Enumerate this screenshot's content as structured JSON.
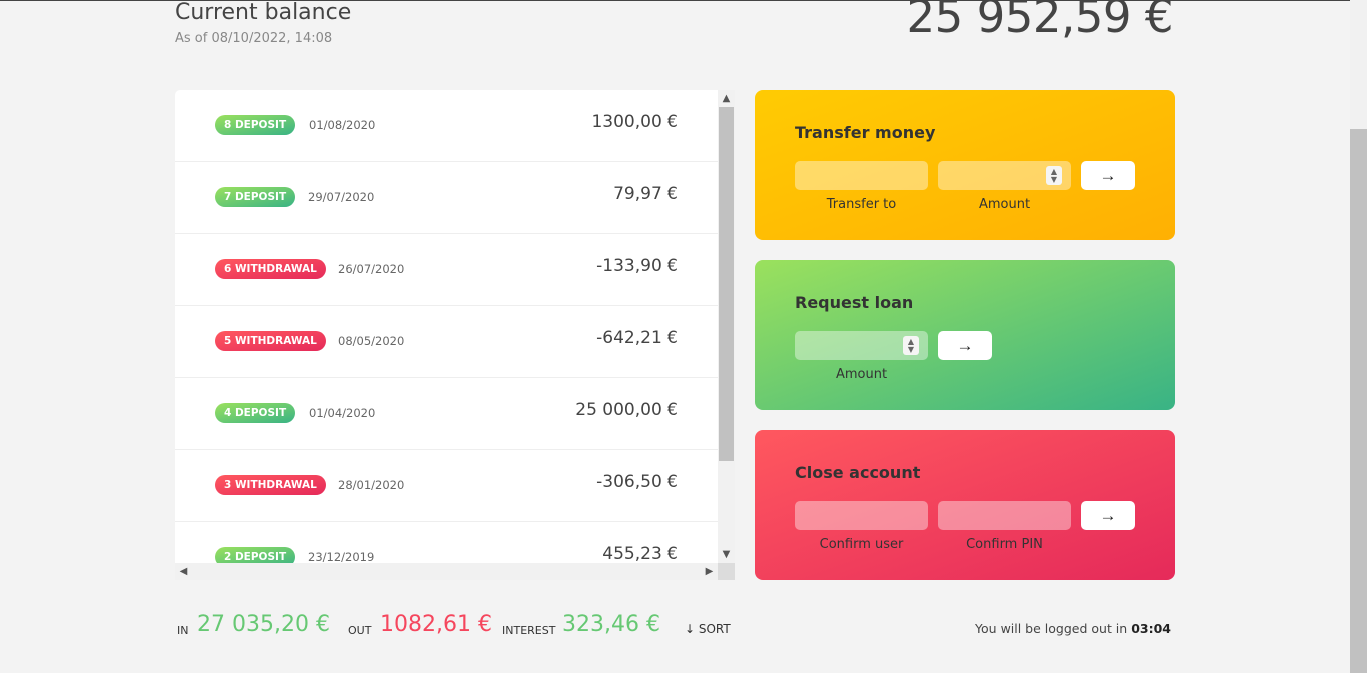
{
  "balance": {
    "label": "Current balance",
    "date_prefix": "As of",
    "date": "08/10/2022, 14:08",
    "value": "25 952,59 €"
  },
  "movements": [
    {
      "badge": "8 DEPOSIT",
      "type": "deposit",
      "date": "01/08/2020",
      "value": "1300,00 €"
    },
    {
      "badge": "7 DEPOSIT",
      "type": "deposit",
      "date": "29/07/2020",
      "value": "79,97 €"
    },
    {
      "badge": "6 WITHDRAWAL",
      "type": "withdrawal",
      "date": "26/07/2020",
      "value": "-133,90 €"
    },
    {
      "badge": "5 WITHDRAWAL",
      "type": "withdrawal",
      "date": "08/05/2020",
      "value": "-642,21 €"
    },
    {
      "badge": "4 DEPOSIT",
      "type": "deposit",
      "date": "01/04/2020",
      "value": "25 000,00 €"
    },
    {
      "badge": "3 WITHDRAWAL",
      "type": "withdrawal",
      "date": "28/01/2020",
      "value": "-306,50 €"
    },
    {
      "badge": "2 DEPOSIT",
      "type": "deposit",
      "date": "23/12/2019",
      "value": "455,23 €"
    }
  ],
  "operations": {
    "transfer": {
      "title": "Transfer money",
      "label_to": "Transfer to",
      "label_amount": "Amount",
      "button": "→"
    },
    "loan": {
      "title": "Request loan",
      "label_amount": "Amount",
      "button": "→"
    },
    "close": {
      "title": "Close account",
      "label_user": "Confirm user",
      "label_pin": "Confirm PIN",
      "button": "→"
    }
  },
  "summary": {
    "in_label": "IN",
    "in_value": "27 035,20 €",
    "out_label": "OUT",
    "out_value": "1082,61 €",
    "interest_label": "INTEREST",
    "interest_value": "323,46 €",
    "sort_label": "↓ SORT"
  },
  "logout": {
    "text": "You will be logged out in",
    "timer": "03:04"
  },
  "colors": {
    "deposit": "#66c873",
    "withdrawal": "#f5465d",
    "transfer": "#ffb003",
    "loan": "#39b385",
    "close": "#e52a5a"
  }
}
